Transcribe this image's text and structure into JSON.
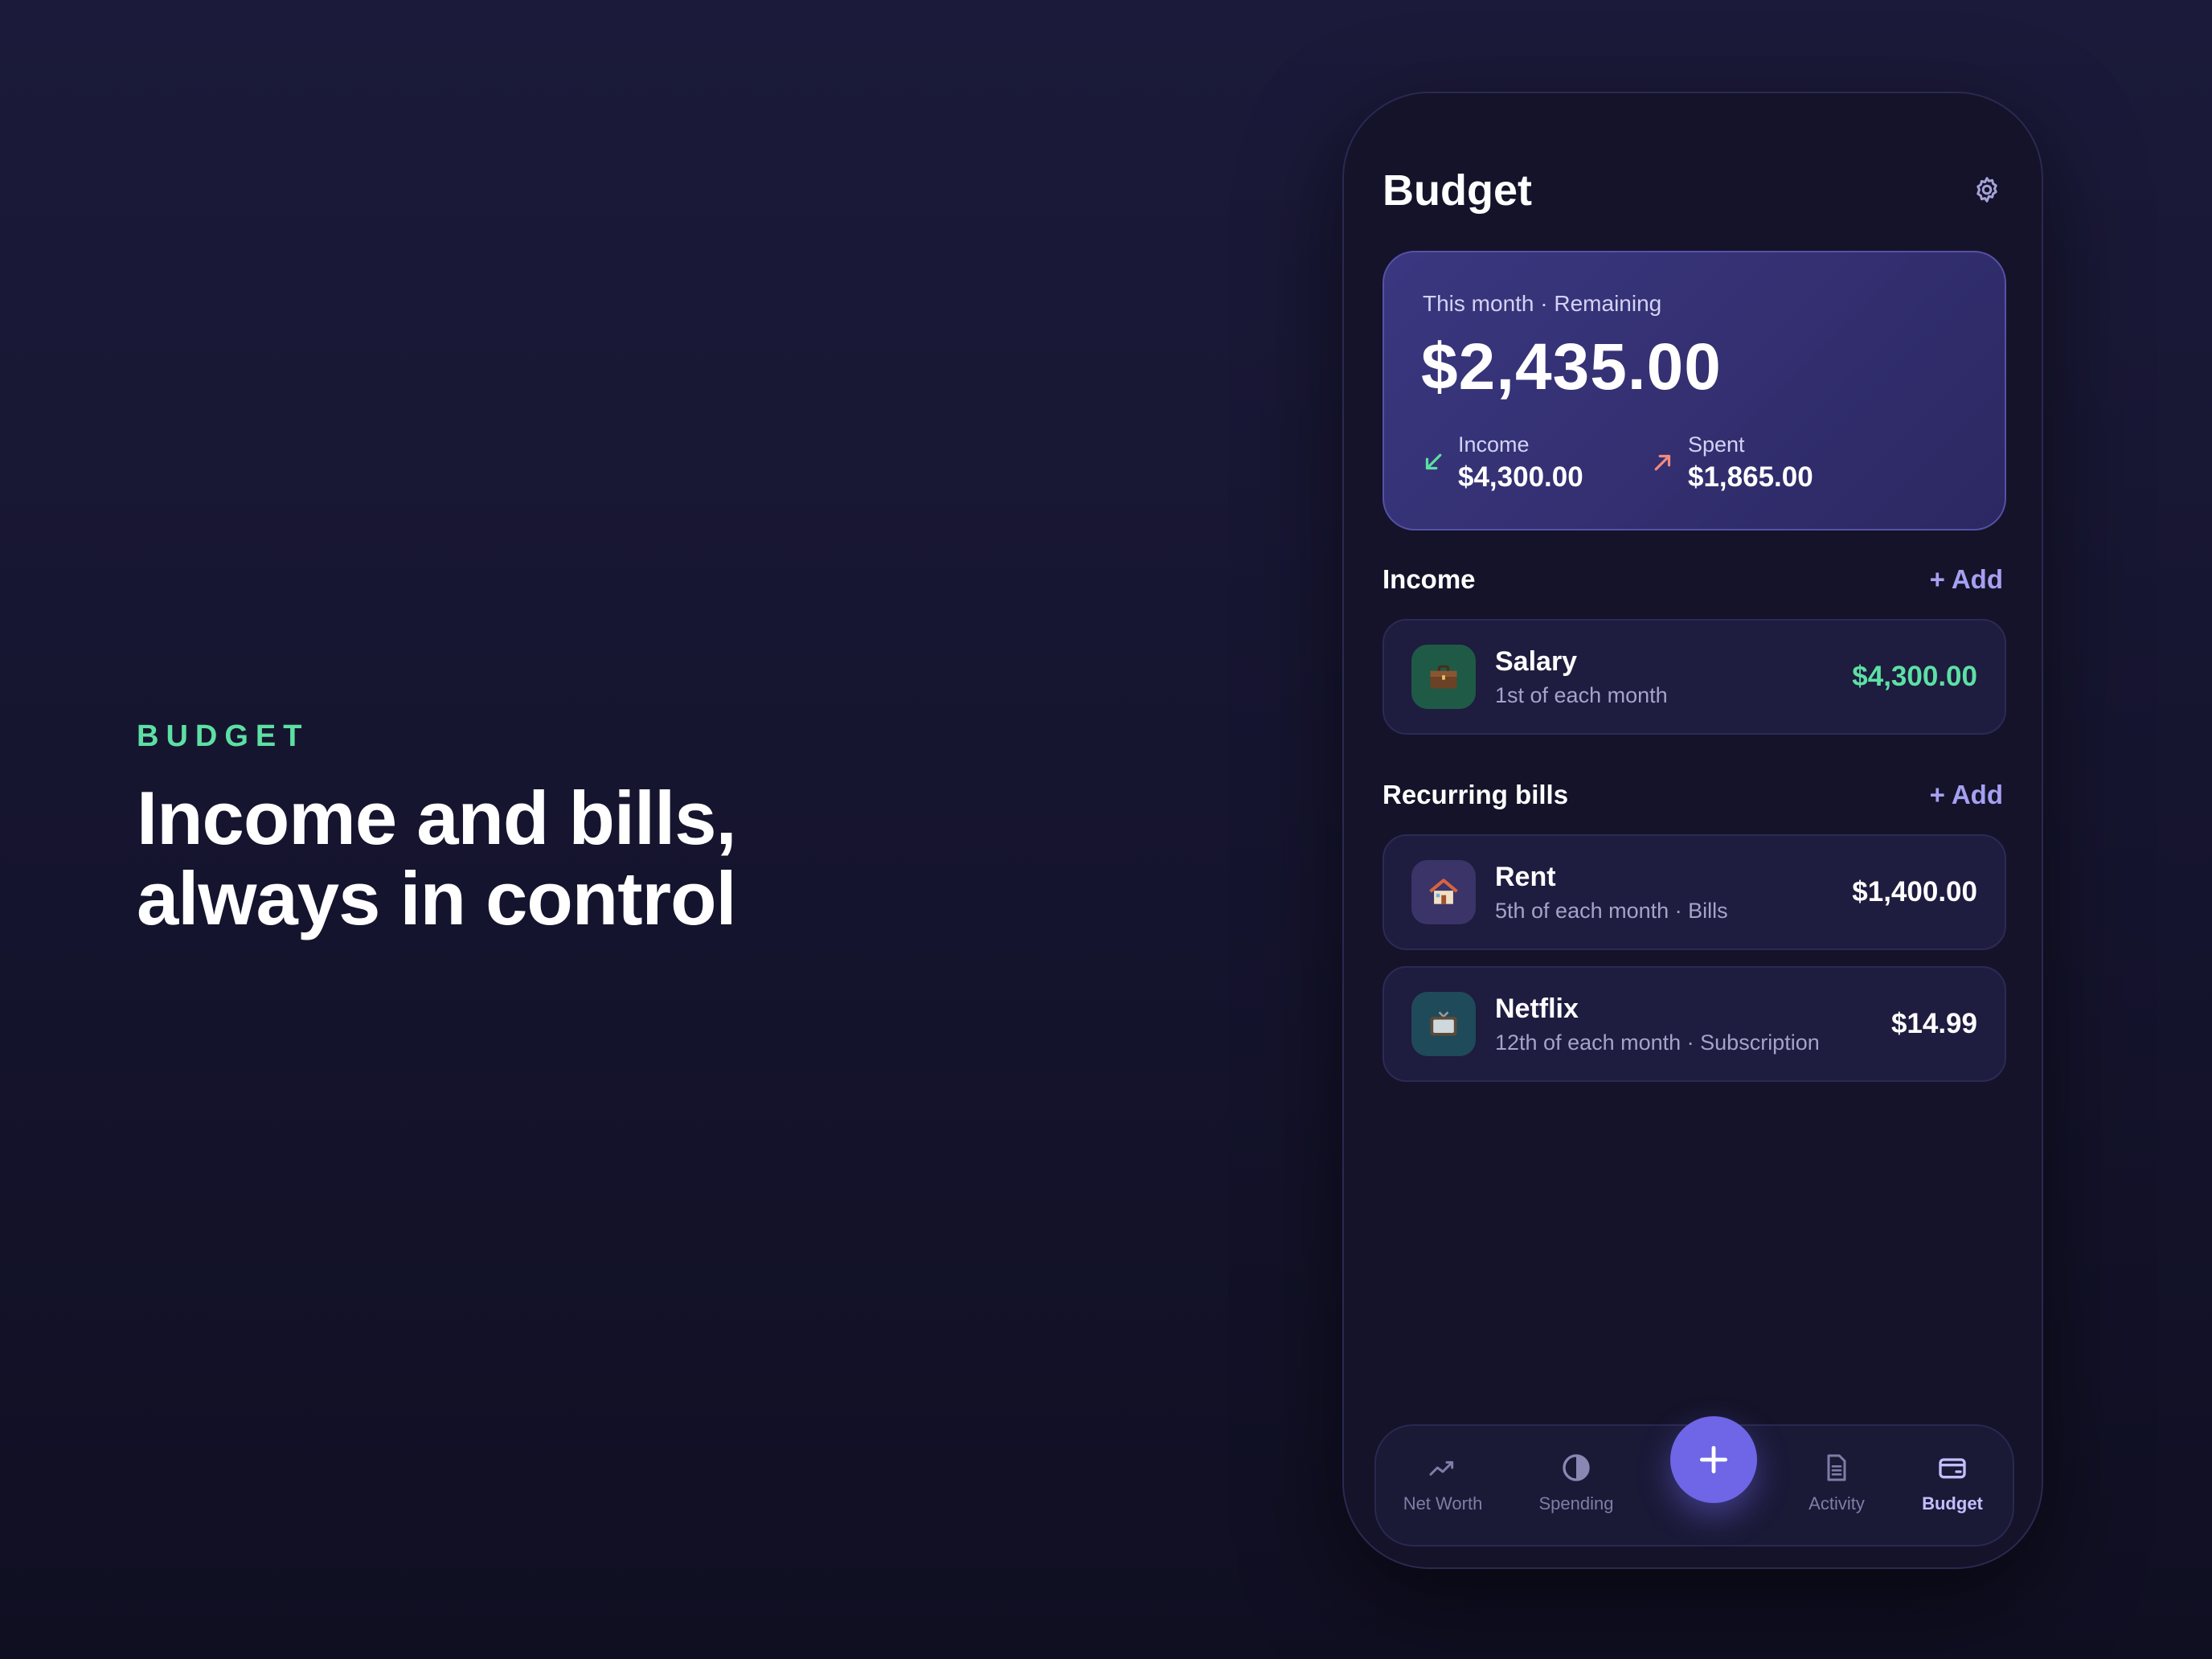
{
  "hero": {
    "eyebrow": "BUDGET",
    "title_line1": "Income and bills,",
    "title_line2": "always in control"
  },
  "screen": {
    "title": "Budget",
    "settings_icon": "gear-icon"
  },
  "summary": {
    "label": "This month · Remaining",
    "remaining": "$2,435.00",
    "income_label": "Income",
    "income_value": "$4,300.00",
    "spent_label": "Spent",
    "spent_value": "$1,865.00",
    "income_icon": "arrow-down-left-icon",
    "spent_icon": "arrow-up-right-icon"
  },
  "income_section": {
    "title": "Income",
    "add_label": "+ Add",
    "items": [
      {
        "name": "Salary",
        "subtitle": "1st of each month",
        "amount": "$4,300.00",
        "icon": "briefcase-icon"
      }
    ]
  },
  "bills_section": {
    "title": "Recurring bills",
    "add_label": "+ Add",
    "items": [
      {
        "name": "Rent",
        "subtitle": "5th of each month · Bills",
        "amount": "$1,400.00",
        "icon": "house-icon"
      },
      {
        "name": "Netflix",
        "subtitle": "12th of each month · Subscription",
        "amount": "$14.99",
        "icon": "tv-icon"
      }
    ]
  },
  "tabbar": {
    "tabs": [
      {
        "label": "Net Worth",
        "icon": "trend-chart-icon"
      },
      {
        "label": "Spending",
        "icon": "half-circle-icon"
      },
      {
        "label": "Activity",
        "icon": "document-icon"
      },
      {
        "label": "Budget",
        "icon": "wallet-icon",
        "active": true
      }
    ],
    "fab_icon": "plus-icon"
  },
  "colors": {
    "accent": "#6e66e6",
    "positive": "#5de0a3",
    "negative": "#f08b7e",
    "background": "#1b1a3a",
    "card": "#1e1c3f"
  }
}
